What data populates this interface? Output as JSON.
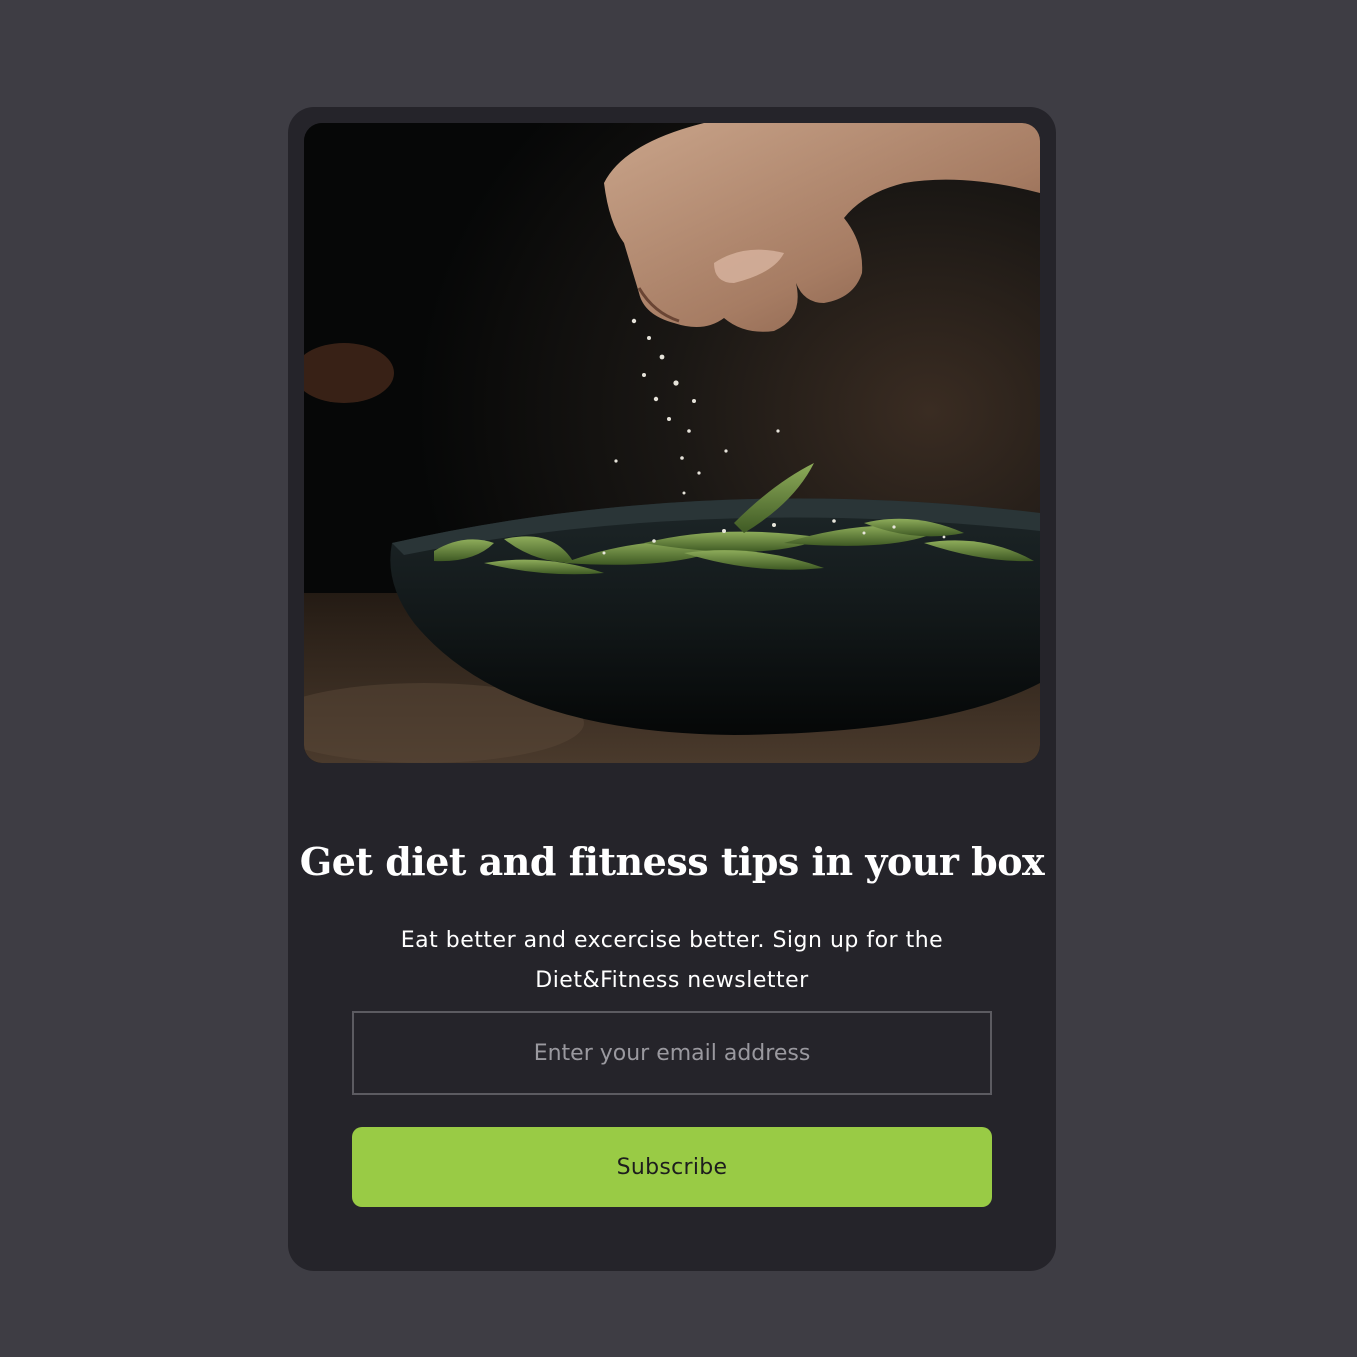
{
  "newsletter": {
    "hero_image": "hand-sprinkling-salt-on-edamame-bowl",
    "title": "Get diet and fitness tips in your box",
    "subtitle": "Eat better and excercise better. Sign up for the Diet&Fitness newsletter",
    "email_placeholder": "Enter your email address",
    "email_value": "",
    "subscribe_label": "Subscribe"
  },
  "colors": {
    "page_background": "#3e3d44",
    "card_background": "#25242a",
    "accent": "#99cb45",
    "input_border": "#5c5b61"
  }
}
